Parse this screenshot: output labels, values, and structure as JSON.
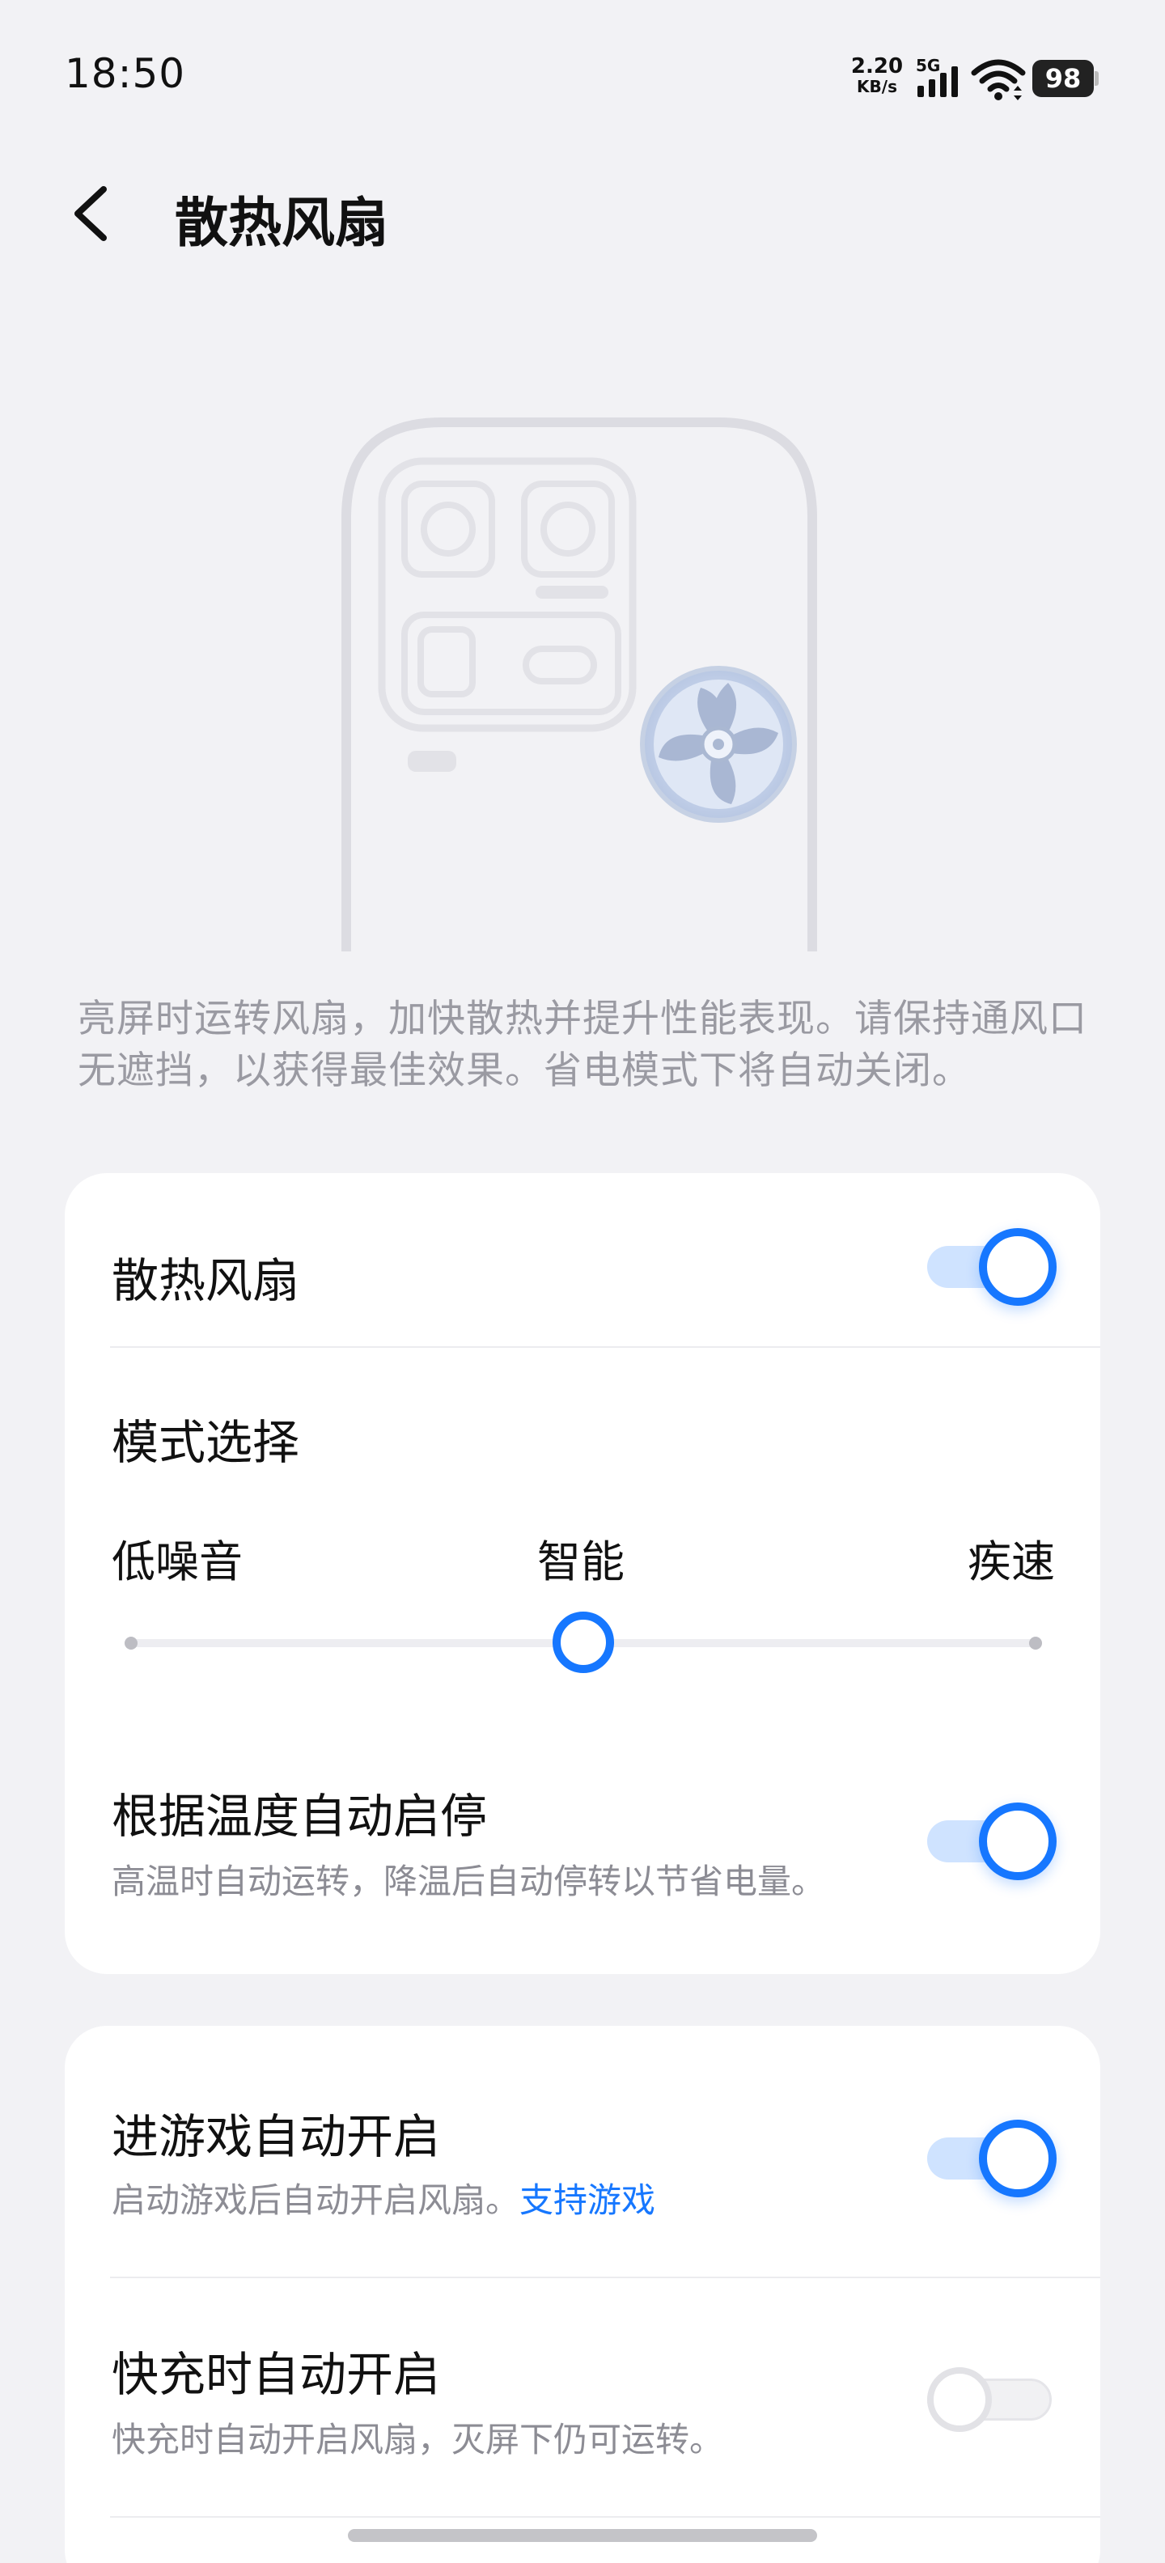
{
  "status_bar": {
    "time": "18:50",
    "net_speed_value": "2.20",
    "net_speed_unit": "KB/s",
    "network_type": "5G",
    "battery": "98"
  },
  "header": {
    "title": "散热风扇"
  },
  "intro_text": "亮屏时运转风扇，加快散热并提升性能表现。请保持通风口无遮挡，以获得最佳效果。省电模式下将自动关闭。",
  "settings_card": {
    "fan_toggle": {
      "label": "散热风扇",
      "enabled": true
    },
    "mode": {
      "label": "模式选择",
      "options": [
        "低噪音",
        "智能",
        "疾速"
      ],
      "selected": "智能"
    },
    "auto_temp": {
      "label": "根据温度自动启停",
      "description": "高温时自动运转，降温后自动停转以节省电量。",
      "enabled": true
    }
  },
  "auto_card": {
    "game": {
      "label": "进游戏自动开启",
      "description": "启动游戏后自动开启风扇。",
      "link": "支持游戏",
      "enabled": true
    },
    "fast_charge": {
      "label": "快充时自动开启",
      "description": "快充时自动开启风扇，灭屏下仍可运转。",
      "enabled": false
    }
  },
  "colors": {
    "accent": "#1677ff",
    "background": "#f2f2f5",
    "card": "#ffffff"
  }
}
